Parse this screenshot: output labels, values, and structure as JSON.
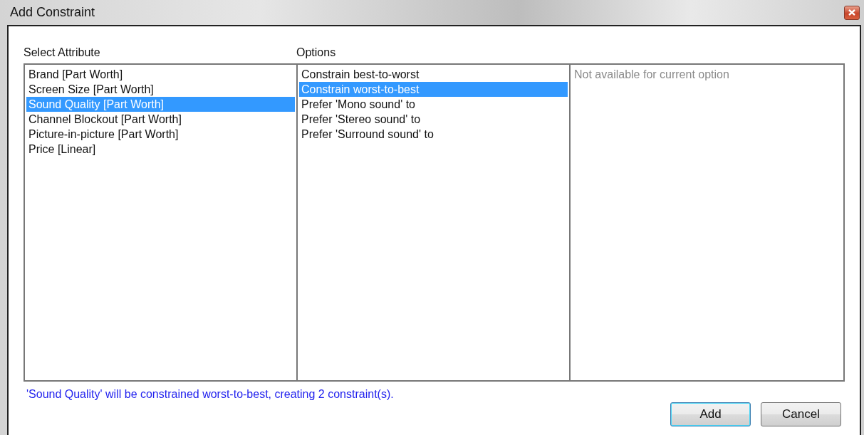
{
  "window": {
    "title": "Add Constraint"
  },
  "attribute_list": {
    "label": "Select Attribute",
    "items": [
      {
        "label": "Brand [Part Worth]",
        "selected": false
      },
      {
        "label": "Screen Size [Part Worth]",
        "selected": false
      },
      {
        "label": "Sound Quality [Part Worth]",
        "selected": true
      },
      {
        "label": "Channel Blockout [Part Worth]",
        "selected": false
      },
      {
        "label": "Picture-in-picture [Part Worth]",
        "selected": false
      },
      {
        "label": "Price [Linear]",
        "selected": false
      }
    ]
  },
  "options_list": {
    "label": "Options",
    "items": [
      {
        "label": "Constrain best-to-worst",
        "selected": false
      },
      {
        "label": "Constrain worst-to-best",
        "selected": true
      },
      {
        "label": "Prefer 'Mono sound' to",
        "selected": false
      },
      {
        "label": "Prefer 'Stereo sound' to",
        "selected": false
      },
      {
        "label": "Prefer 'Surround sound' to",
        "selected": false
      }
    ]
  },
  "detail_panel": {
    "message": "Not available for current option"
  },
  "status_message": "'Sound Quality' will be constrained worst-to-best, creating 2 constraint(s).",
  "buttons": [
    {
      "label": "Add",
      "default": true
    },
    {
      "label": "Cancel",
      "default": false
    }
  ]
}
